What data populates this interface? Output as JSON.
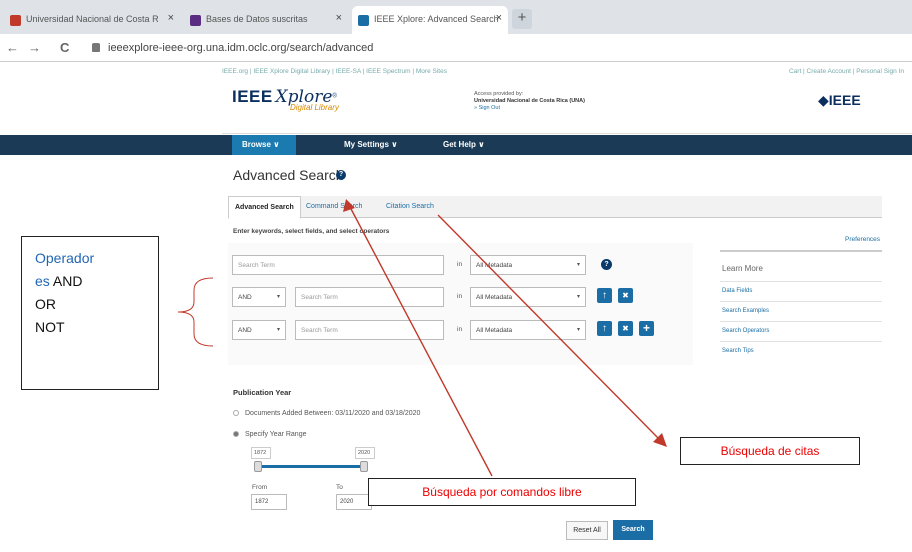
{
  "browser": {
    "tabs": [
      {
        "label": "Universidad Nacional de Costa R",
        "close": "×"
      },
      {
        "label": "Bases de Datos suscritas",
        "close": "×"
      },
      {
        "label": "IEEE Xplore: Advanced Search",
        "close": "×"
      }
    ],
    "new_tab": "+",
    "back": "←",
    "forward": "→",
    "reload": "C",
    "url": "ieeexplore-ieee-org.una.idm.oclc.org/search/advanced"
  },
  "ieee": {
    "utility_left": "IEEE.org  |  IEEE Xplore Digital Library  |  IEEE-SA  |  IEEE Spectrum  |  More Sites",
    "utility_right": "Cart  |  Create Account  |  Personal Sign In",
    "logo_ieee": "IEEE",
    "logo_xplore": "Xplore",
    "logo_reg": "®",
    "logo_sub": "Digital Library",
    "access_label": "Access provided by:",
    "access_inst": "Universidad Nacional de Costa Rica (UNA)",
    "sign_out": "» Sign Out",
    "ieee_right": "◆IEEE"
  },
  "nav": {
    "browse": "Browse ∨",
    "settings": "My Settings ∨",
    "help": "Get Help ∨"
  },
  "page": {
    "title": "Advanced Search",
    "help_icon": "?",
    "tabs": [
      "Advanced Search",
      "Command Search",
      "Citation Search"
    ],
    "instructions": "Enter keywords, select fields, and select operators",
    "preferences": "Preferences",
    "rows": [
      {
        "operator": "",
        "placeholder": "Search Term",
        "in": "in",
        "field": "All Metadata"
      },
      {
        "operator": "AND",
        "placeholder": "Search Term",
        "in": "in",
        "field": "All Metadata"
      },
      {
        "operator": "AND",
        "placeholder": "Search Term",
        "in": "in",
        "field": "All Metadata"
      }
    ],
    "caret": "▾",
    "up_glyph": "↑",
    "remove_glyph": "✖",
    "add_glyph": "+",
    "learn_more": {
      "heading": "Learn More",
      "links": [
        "Data Fields",
        "Search Examples",
        "Search Operators",
        "Search Tips"
      ]
    },
    "publication": {
      "heading": "Publication Year",
      "option1": "Documents Added Between: 03/11/2020 and 03/18/2020",
      "option2": "Specify Year Range",
      "min": "1872",
      "max": "2020",
      "range_start": 0.0,
      "range_end": 1.0,
      "from_label": "From",
      "to_label": "To",
      "from_value": "1872",
      "to_value": "2020"
    },
    "reset": "Reset All",
    "search": "Search"
  },
  "annotations": {
    "operators_line1": "Operador",
    "operators_line2_blue": "es",
    "operators_line2_rest": " AND",
    "operators_line3": "OR",
    "operators_line4": "NOT",
    "citation_callout": "Búsqueda de citas",
    "command_callout": "Búsqueda por comandos libre"
  },
  "colors": {
    "nav_bg": "#1a3a55",
    "primary": "#1b6ea5",
    "annotation_red": "#e00000",
    "arrow": "#c0392b"
  }
}
